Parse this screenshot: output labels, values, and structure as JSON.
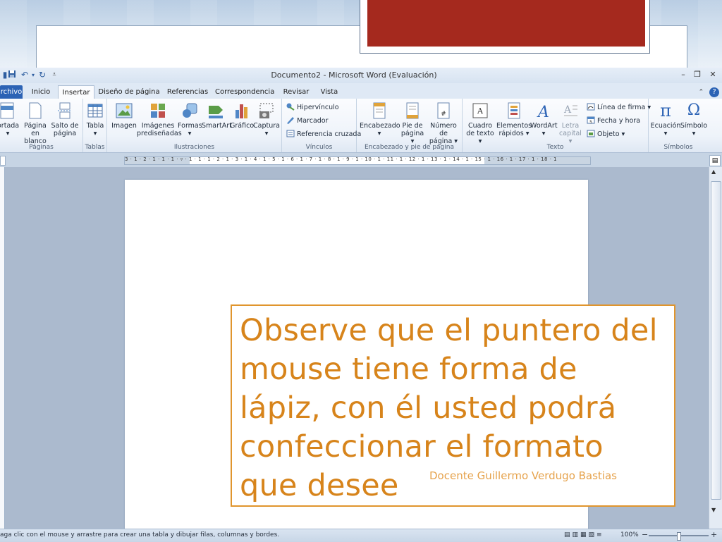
{
  "window": {
    "title": "Documento2  -  Microsoft Word (Evaluación)"
  },
  "tabs": [
    "rchivo",
    "Inicio",
    "Insertar",
    "Diseño de página",
    "Referencias",
    "Correspondencia",
    "Revisar",
    "Vista"
  ],
  "ribbon": {
    "paginas": {
      "label": "Páginas",
      "portada": "ortada",
      "en_blanco_1": "Página",
      "en_blanco_2": "en blanco",
      "salto_1": "Salto de",
      "salto_2": "página"
    },
    "tablas": {
      "label": "Tablas",
      "tabla": "Tabla"
    },
    "ilustraciones": {
      "label": "Ilustraciones",
      "imagen": "Imagen",
      "predis_1": "Imágenes",
      "predis_2": "prediseñadas",
      "formas": "Formas",
      "smartart": "SmartArt",
      "grafico": "Gráfico",
      "captura": "Captura"
    },
    "vinculos": {
      "label": "Vínculos",
      "hipervinculo": "Hipervínculo",
      "marcador": "Marcador",
      "referencia": "Referencia cruzada"
    },
    "encabezado_pie": {
      "label": "Encabezado y pie de página",
      "encabezado": "Encabezado",
      "pie_1": "Pie de",
      "pie_2": "página",
      "numero_1": "Número de",
      "numero_2": "página"
    },
    "texto": {
      "label": "Texto",
      "cuadro_1": "Cuadro",
      "cuadro_2": "de texto",
      "elementos_1": "Elementos",
      "elementos_2": "rápidos",
      "wordart": "WordArt",
      "letra_1": "Letra",
      "letra_2": "capital",
      "linea_firma": "Línea de firma",
      "fecha_hora": "Fecha y hora",
      "objeto": "Objeto"
    },
    "simbolos": {
      "label": "Símbolos",
      "ecuacion": "Ecuación",
      "simbolo": "Símbolo"
    }
  },
  "ruler": {
    "numbers": "3 · 1 · 2 · 1 · 1 · 1 · ▿ · 1 · 1 · 1 · 2 · 1 · 3 · 1 · 4 · 1 · 5 · 1 · 6 · 1 · 7 · 1 · 8 · 1 · 9 · 1 · 10 · 1 · 11 · 1 · 12 · 1 · 13 · 1 · 14 · 1 · 15 · 1 · 16 · 1 · 17 · 1 · 18 · 1"
  },
  "statusbar": {
    "text": "aga clic con el mouse y arrastre para crear una tabla y dibujar filas, columnas y bordes.",
    "zoom": "100%"
  },
  "slide": {
    "main_text": "Observe que el puntero del mouse tiene forma de lápiz, con él usted podrá confeccionar el formato que desee",
    "credit": "Docente Guillermo Verdugo Bastias"
  }
}
